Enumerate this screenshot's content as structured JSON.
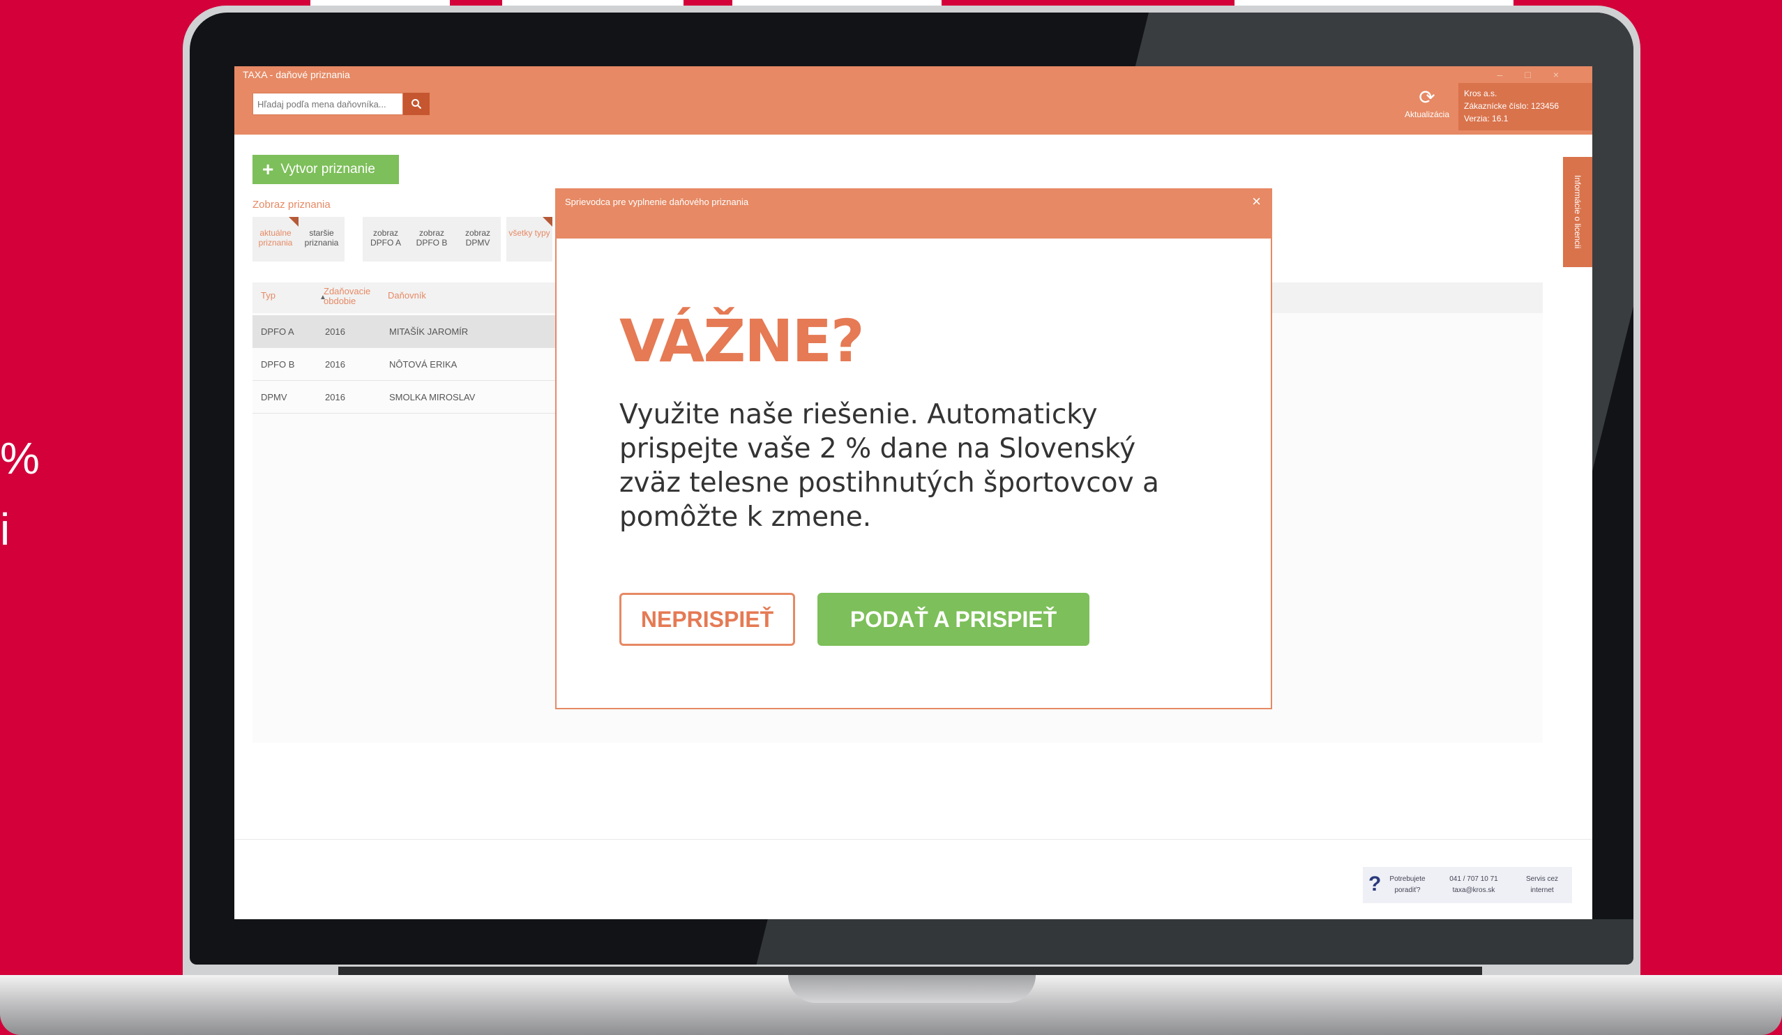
{
  "background": {
    "color": "#d3003a",
    "fragment_1": "%",
    "fragment_2": "i"
  },
  "app": {
    "window_title": "TAXA - daňové priznania",
    "search_placeholder": "Hľadaj podľa mena daňovníka...",
    "search_icon": "search-icon",
    "refresh_label": "Aktualizácia",
    "customer": {
      "name": "Kros a.s.",
      "number": "Zákaznícke číslo: 123456",
      "version": "Verzia: 16.1"
    },
    "accent_color": "#e68964",
    "create_label": "Vytvor priznanie",
    "filter_label": "Zobraz priznania",
    "filters": [
      {
        "label": "aktuálne priznania"
      },
      {
        "label": "staršie priznania"
      },
      {
        "label": "zobraz DPFO A"
      },
      {
        "label": "zobraz DPFO B"
      },
      {
        "label": "zobraz DPMV"
      },
      {
        "label": "všetky typy"
      }
    ],
    "table": {
      "headers": {
        "typ": "Typ",
        "obdobie": "Zdaňovacie obdobie",
        "danovnik": "Daňovník"
      },
      "rows": [
        {
          "typ": "DPFO A",
          "obdobie": "2016",
          "danovnik": "MITAŠÍK JAROMÍR"
        },
        {
          "typ": "DPFO B",
          "obdobie": "2016",
          "danovnik": "NÔTOVÁ ERIKA"
        },
        {
          "typ": "DPMV",
          "obdobie": "2016",
          "danovnik": "SMOLKA MIROSLAV"
        }
      ]
    },
    "license_tab": "Informácie o licencii",
    "help": {
      "need": "Potrebujete poradiť?",
      "contact": "041 / 707 10 71 taxa@kros.sk",
      "service": "Servis cez internet"
    }
  },
  "modal": {
    "title": "Sprievodca pre vyplnenie daňového priznania",
    "heading": "VÁŽNE?",
    "text": "Využite naše riešenie. Automaticky prispejte vaše 2 % dane na Slovenský zväz telesne postihnutých športovcov a pomôžte k zmene.",
    "decline_label": "NEPRISPIEŤ",
    "submit_label": "PODAŤ A PRISPIEŤ",
    "button_green": "#7dbf5a"
  }
}
